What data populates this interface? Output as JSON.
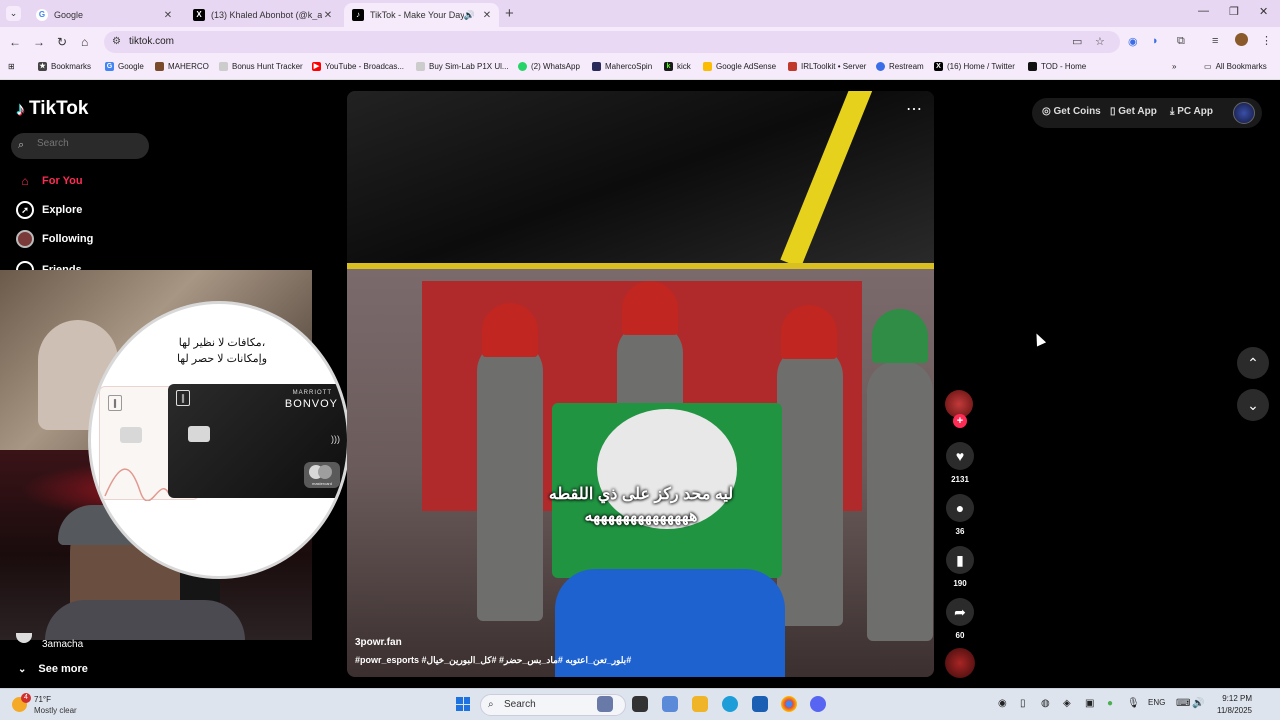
{
  "browser": {
    "tabs": [
      {
        "label": "Google",
        "icon": "G",
        "color": "#4285f4",
        "active": false
      },
      {
        "label": "(13) Khaled Abonbot (@k_abon",
        "icon": "X",
        "color": "#000000",
        "active": false
      },
      {
        "label": "TikTok - Make Your Day",
        "icon": "♪",
        "color": "#000000",
        "active": true
      }
    ],
    "url": "tiktok.com",
    "bookmarks": [
      {
        "label": "Bookmarks",
        "color": "#444444"
      },
      {
        "label": "Google",
        "color": "#4285f4"
      },
      {
        "label": "MAHERCO",
        "color": "#7a4b2a"
      },
      {
        "label": "Bonus Hunt Tracker",
        "color": "#cccccc"
      },
      {
        "label": "YouTube - Broadcas...",
        "color": "#ff0000"
      },
      {
        "label": "Buy Sim-Lab P1X Ul...",
        "color": "#cccccc"
      },
      {
        "label": "(2) WhatsApp",
        "color": "#25d366"
      },
      {
        "label": "MahercoSpin",
        "color": "#2a2a5a"
      },
      {
        "label": "kick",
        "color": "#53fc18"
      },
      {
        "label": "Google AdSense",
        "color": "#fbbc04"
      },
      {
        "label": "IRLToolkit • Server",
        "color": "#c0392b"
      },
      {
        "label": "Restream",
        "color": "#3a6ee8"
      },
      {
        "label": "(16) Home / Twitter",
        "color": "#000000"
      },
      {
        "label": "TOD - Home",
        "color": "#111111"
      }
    ],
    "all_bookmarks": "All Bookmarks"
  },
  "sidebar": {
    "logo": "TikTok",
    "search_placeholder": "Search",
    "nav": [
      {
        "label": "For You",
        "active": true
      },
      {
        "label": "Explore",
        "active": false
      },
      {
        "label": "Following",
        "active": false
      },
      {
        "label": "Friends",
        "active": false
      }
    ],
    "following_user": "3amacha",
    "see_more": "See more"
  },
  "promo": {
    "line1": "مكافات لا نظير لها،",
    "line2": "وإمكانات لا حصر لها",
    "brand_small": "MARRIOTT",
    "brand": "BONVOY",
    "card_network": "mastercard"
  },
  "video": {
    "caption_line1": "ليه محد ركز على ذي اللقطه",
    "caption_line2": "ههههههههههههههه",
    "author": "3powr.fan",
    "tags": "#powr_esports #بلور_تعن_اعتوبه #ماد_بس_حضر# #كل_البورين_خيال#",
    "likes": "2131",
    "comments": "36",
    "saves": "190",
    "shares": "60"
  },
  "topbar": {
    "coins": "Get Coins",
    "app": "Get App",
    "pc": "PC App"
  },
  "taskbar": {
    "weather_temp": "71°F",
    "weather_cond": "Mostly clear",
    "weather_badge": "4",
    "search": "Search",
    "lang": "ENG",
    "time": "9:12 PM",
    "date": "11/8/2025"
  }
}
